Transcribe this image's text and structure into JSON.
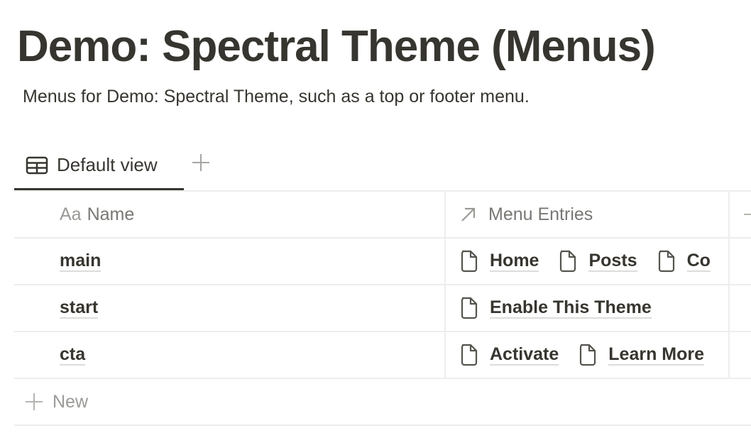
{
  "page": {
    "title": "Demo: Spectral Theme (Menus)",
    "description": "Menus for Demo: Spectral Theme, such as a top or footer menu."
  },
  "views": {
    "tabs": [
      {
        "label": "Default view",
        "icon": "table-icon",
        "active": true
      }
    ],
    "add_view_icon": "plus-icon"
  },
  "table": {
    "columns": [
      {
        "label": "Name",
        "icon": "text-property-icon",
        "icon_glyph": "Aa"
      },
      {
        "label": "Menu Entries",
        "icon": "relation-arrow-icon"
      }
    ],
    "rows": [
      {
        "name": "main",
        "entries": [
          "Home",
          "Posts",
          "Co"
        ]
      },
      {
        "name": "start",
        "entries": [
          "Enable This Theme"
        ]
      },
      {
        "name": "cta",
        "entries": [
          "Activate",
          "Learn More"
        ]
      }
    ],
    "new_label": "New"
  }
}
